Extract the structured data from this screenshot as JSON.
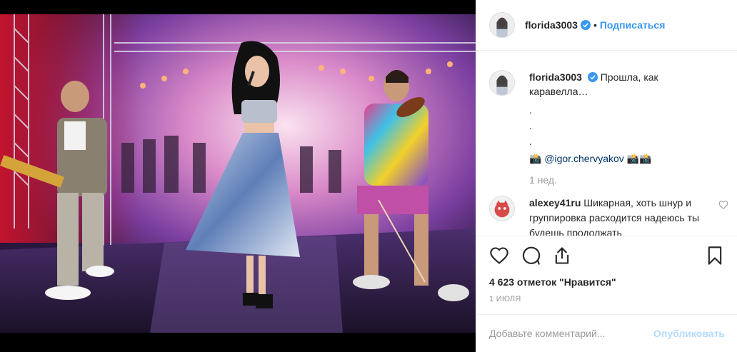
{
  "post": {
    "author": "florida3003",
    "follow_label": "Подписаться",
    "dot": "•"
  },
  "caption": {
    "username": "florida3003",
    "text_line1": "Прошла, как",
    "text_line2": "каравелла…",
    "dot1": ".",
    "dot2": ".",
    "dot3": ".",
    "emoji_prefix": "📸",
    "mention": "@igor.chervyakov",
    "emoji_suffix": "📸📸",
    "time_ago": "1 нед."
  },
  "comments": [
    {
      "username": "alexey41ru",
      "text": "Шикарная, хоть шнур и группировка расходится надеюсь ты будешь продолжать"
    }
  ],
  "actions": {
    "likes": "4 623 отметок \"Нравится\"",
    "date": "1 ИЮЛЯ"
  },
  "add_comment": {
    "placeholder": "Добавьте комментарий...",
    "publish_label": "Опубликовать"
  },
  "colors": {
    "accent": "#3897f0",
    "verified": "#3897f0",
    "publish_disabled": "#b3dbff",
    "muted": "#999999"
  },
  "icons": [
    "verified-icon",
    "heart-icon",
    "comment-icon",
    "share-icon",
    "bookmark-icon",
    "heart-small-icon"
  ]
}
